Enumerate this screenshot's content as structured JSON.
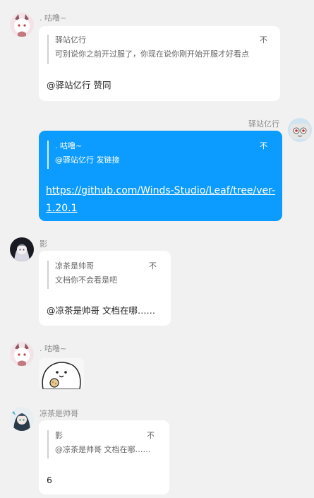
{
  "messages": [
    {
      "sender": ". 咕噜~",
      "quote_author": "驿站亿行",
      "quote_close": "不",
      "quote_text": "可别说你之前开过服了，你现在说你刚开始开服才好看点",
      "reply": "@驿站亿行 赞同"
    },
    {
      "sender": "驿站亿行",
      "quote_author": ". 咕噜~",
      "quote_close": "不",
      "quote_text": "@驿站亿行 发链接",
      "link_text": "https://github.com/Winds-Studio/Leaf/tree/ver-1.20.1"
    },
    {
      "sender": "影",
      "quote_author": "凉茶是帅哥",
      "quote_close": "不",
      "quote_text": "文档你不会看是吧",
      "reply": "@凉茶是帅哥 文档在哪……"
    },
    {
      "sender": ". 咕噜~",
      "sticker": "white-blob-cookie-sticker"
    },
    {
      "sender": "凉茶是帅哥",
      "quote_author": "影",
      "quote_close": "不",
      "quote_text": "@凉茶是帅哥 文档在哪……",
      "reply": "6"
    }
  ],
  "colors": {
    "background": "#f1f1f1",
    "bubble": "#ffffff",
    "self_bubble": "#0c9cff"
  }
}
